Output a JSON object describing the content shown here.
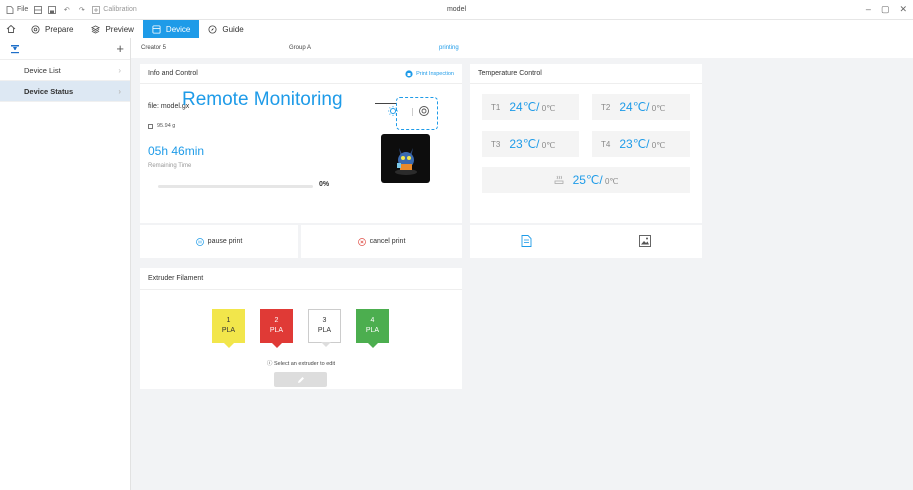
{
  "titlebar": {
    "file_label": "File",
    "calibration_label": "Calibration",
    "window_title": "model"
  },
  "nav": {
    "tabs": [
      {
        "label": "Prepare"
      },
      {
        "label": "Preview"
      },
      {
        "label": "Device"
      },
      {
        "label": "Guide"
      }
    ]
  },
  "sidebar": {
    "items": [
      {
        "label": "Device List"
      },
      {
        "label": "Device Status"
      }
    ]
  },
  "status": {
    "printer": "Creator 5",
    "group": "Group A",
    "state": "printing"
  },
  "info": {
    "title": "Info and Control",
    "inspection": "Print Inspection",
    "file": "file: model.gx",
    "weight": "95.94 g",
    "remaining_time": "05h 46min",
    "remaining_label": "Remaining Time",
    "progress_percent": 0,
    "progress_text": "0%",
    "callout": "Remote Monitoring"
  },
  "temperature": {
    "title": "Temperature Control",
    "heads": [
      {
        "label": "T1",
        "current": "24℃/",
        "target": "0℃"
      },
      {
        "label": "T2",
        "current": "24℃/",
        "target": "0℃"
      },
      {
        "label": "T3",
        "current": "23℃/",
        "target": "0℃"
      },
      {
        "label": "T4",
        "current": "23℃/",
        "target": "0℃"
      }
    ],
    "bed": {
      "current": "25℃/",
      "target": "0℃"
    }
  },
  "actions": {
    "pause": "pause print",
    "cancel": "cancel print"
  },
  "extruder": {
    "title": "Extruder  Filament",
    "slots": [
      {
        "num": "1",
        "material": "PLA",
        "color": "#f2e64b",
        "text_color": "#333333"
      },
      {
        "num": "2",
        "material": "PLA",
        "color": "#e03a36",
        "text_color": "#ffffff"
      },
      {
        "num": "3",
        "material": "PLA",
        "color": "#ffffff",
        "text_color": "#333333"
      },
      {
        "num": "4",
        "material": "PLA",
        "color": "#4cae4f",
        "text_color": "#ffffff"
      }
    ],
    "hint": "Select an extruder to edit"
  },
  "colors": {
    "accent": "#1e9be8",
    "active_sidebar": "#dde8f3"
  }
}
